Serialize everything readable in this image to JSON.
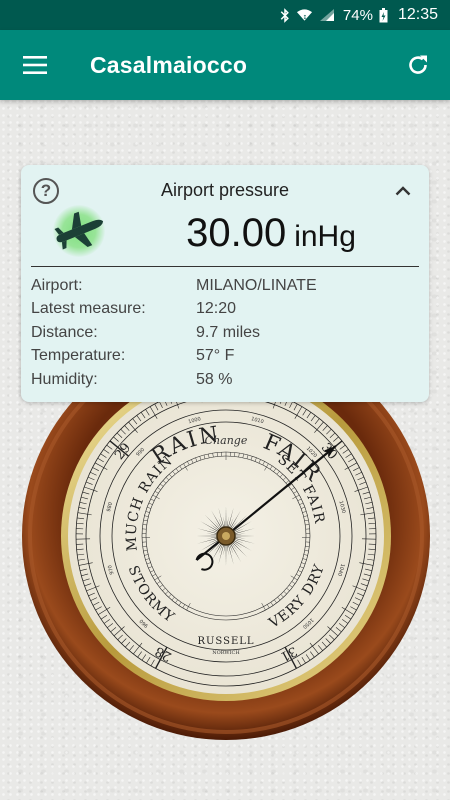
{
  "status_bar": {
    "icons": [
      "bluetooth-icon",
      "wifi-icon",
      "signal-icon",
      "battery-icon"
    ],
    "battery": "74%",
    "time": "12:35"
  },
  "app_bar": {
    "title": "Casalmaiocco",
    "menu_icon": "hamburger-menu-icon",
    "refresh_icon": "refresh-icon",
    "color": "#00897b"
  },
  "card": {
    "help_symbol": "?",
    "title": "Airport pressure",
    "pressure_value": "30.00",
    "pressure_unit": "inHg",
    "details": [
      {
        "label": "Airport:",
        "value": "MILANO/LINATE"
      },
      {
        "label": "Latest measure:",
        "value": "12:20"
      },
      {
        "label": "Distance:",
        "value": "9.7 miles"
      },
      {
        "label": "Temperature:",
        "value": "57° F"
      },
      {
        "label": "Humidity:",
        "value": "58 %"
      }
    ],
    "background": "#e2f3f2"
  },
  "barometer": {
    "labels": {
      "rain": "RAIN",
      "change": "Change",
      "fair": "FAIR",
      "much_rain": "MUCH RAIN",
      "set_fair": "SET FAIR",
      "stormy": "STORMY",
      "very_dry": "VERY DRY",
      "maker": "RUSSELL",
      "maker_city": "NORWICH"
    },
    "inhg_labels": [
      "28",
      "29",
      "30",
      "31"
    ],
    "mb_labels": [
      "960",
      "970",
      "980",
      "990",
      "1000",
      "1010",
      "1020",
      "1030",
      "1040",
      "1050"
    ],
    "needle_reading_inhg": 30.0
  }
}
